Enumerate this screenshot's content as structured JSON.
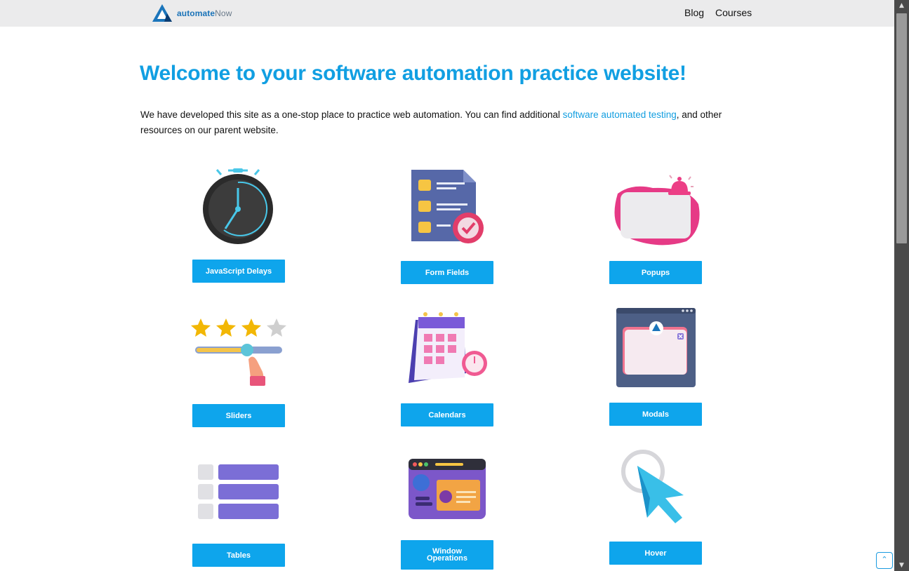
{
  "header": {
    "logo_text_bold": "automate",
    "logo_text_light": "Now",
    "nav": [
      {
        "label": "Blog"
      },
      {
        "label": "Courses"
      }
    ]
  },
  "main": {
    "title": "Welcome to your software automation practice website!",
    "intro_before": "We have developed this site as a one-stop place to practice web automation. You can find additional ",
    "intro_link": "software automated testing",
    "intro_after": ", and other resources on our parent website."
  },
  "cards": [
    {
      "label": "JavaScript Delays",
      "icon": "stopwatch-icon"
    },
    {
      "label": "Form Fields",
      "icon": "form-checklist-icon"
    },
    {
      "label": "Popups",
      "icon": "popup-bell-icon"
    },
    {
      "label": "Sliders",
      "icon": "star-slider-icon"
    },
    {
      "label": "Calendars",
      "icon": "calendar-icon"
    },
    {
      "label": "Modals",
      "icon": "modal-window-icon"
    },
    {
      "label": "Tables",
      "icon": "table-rows-icon"
    },
    {
      "label": "Window Operations",
      "icon": "browser-window-icon"
    },
    {
      "label": "Hover",
      "icon": "cursor-pointer-icon"
    }
  ],
  "colors": {
    "accent": "#0ea5ec",
    "title": "#119fe2",
    "header_bg": "#ebebec"
  },
  "scroll_position_fraction": 0
}
